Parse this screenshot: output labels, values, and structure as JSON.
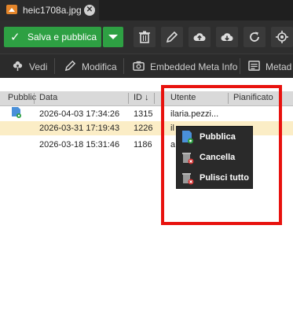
{
  "tab": {
    "title": "heic1708a.jpg",
    "close": "✕"
  },
  "toolbar": {
    "save_label": "Salva e pubblica"
  },
  "subbar": {
    "vedi": "Vedi",
    "modifica": "Modifica",
    "embedded": "Embedded Meta Info",
    "metadata": "Metad"
  },
  "table": {
    "headers": {
      "pubblic": "Pubblic",
      "data": "Data",
      "id": "ID ↓",
      "utente": "Utente",
      "pianificato": "Pianificato"
    },
    "rows": [
      {
        "data": "2026-04-03 17:34:26",
        "id": "1315",
        "utente": "ilaria.pezzi..."
      },
      {
        "data": "2026-03-31 17:19:43",
        "id": "1226",
        "utente": "il"
      },
      {
        "data": "2026-03-18 15:31:46",
        "id": "1186",
        "utente": "a"
      }
    ]
  },
  "context_menu": {
    "items": [
      "Pubblica",
      "Cancella",
      "Pulisci tutto"
    ]
  },
  "colors": {
    "accent_green": "#2ea043",
    "highlight_red": "#e8120e",
    "selected_row": "#fbedc6"
  }
}
